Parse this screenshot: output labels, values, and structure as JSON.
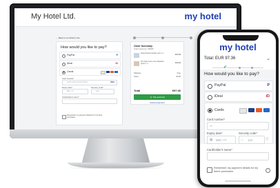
{
  "colors": {
    "brand": "#1f3fb3",
    "pay_button": "#2e9b45"
  },
  "desktop": {
    "hotel_name": "My Hotel Ltd.",
    "brand": "my hotel",
    "back_link": "← Back to merchant's site",
    "question": "How would you like to pay?",
    "options": [
      {
        "label": "PayPal",
        "icon": "paypal-icon",
        "icon_text": "P"
      },
      {
        "label": "iDeal",
        "icon": "ideal-icon",
        "icon_text": "iD"
      },
      {
        "label": "Cards",
        "icon": "cards-icon",
        "icon_text": ""
      }
    ],
    "card_number_label": "Card number*",
    "card_number_placeholder": "XXXX XXXX XXXX XXXX",
    "expiry_label": "Expiry date*",
    "expiry_placeholder": "MM / YY",
    "cvc_label": "Security code*",
    "cvc_placeholder": "123",
    "holder_label": "Cardholder's name*",
    "remember_text": "Remember my payment details for my future purchases",
    "summary": {
      "title": "Order Summary",
      "reference": "Order reference: 728968",
      "items": [
        {
          "name": "Superimposed private room × 1",
          "price": "€22.84"
        },
        {
          "name": "The basic home room Standard queen × 1",
          "price": "€24.62"
        }
      ],
      "shipping_label": "Shipping",
      "shipping_value": "Free",
      "taxes_label": "Taxes",
      "taxes_value": "€4.90",
      "total_label": "Total",
      "total_value": "€97.36",
      "pay_label": "🔒 Pay securely",
      "cancel_label": "Cancel payment"
    }
  },
  "mobile": {
    "brand": "my hotel",
    "total": "Total: EUR 97.36",
    "question": "How would you like to pay?",
    "options": [
      {
        "label": "PayPal",
        "icon": "paypal-icon",
        "icon_text": "P"
      },
      {
        "label": "iDeal",
        "icon": "ideal-icon",
        "icon_text": "iD"
      },
      {
        "label": "Cards",
        "icon": "cards-icon",
        "icon_text": ""
      }
    ],
    "card_number_label": "Card number*",
    "expiry_label": "Expiry date*",
    "expiry_placeholder": "MM / YY",
    "cvc_label": "Security code*",
    "cvc_placeholder": "123",
    "holder_label": "Cardholder's name*",
    "remember_text": "Remember my payment details for my future purchases"
  }
}
